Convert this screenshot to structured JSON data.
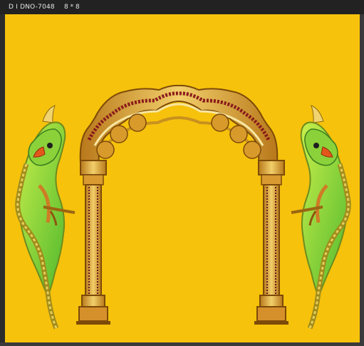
{
  "window": {
    "file_name": "D I DNO-7048",
    "size_label": "8 * 8"
  },
  "canvas": {
    "background_color": "#f6c20c",
    "motifs": [
      "arch-icon",
      "left-parrot-icon",
      "right-parrot-icon"
    ]
  }
}
